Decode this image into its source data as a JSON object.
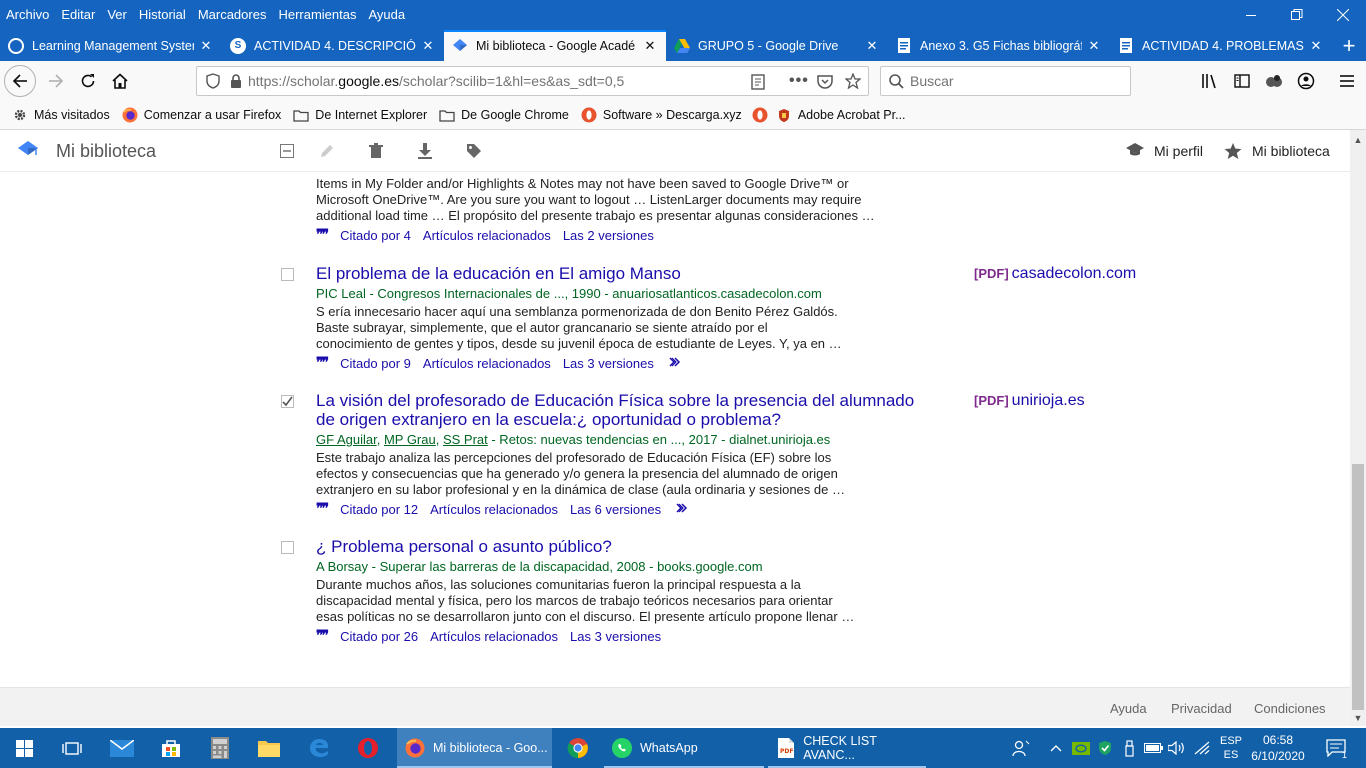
{
  "browser": {
    "menu": [
      "Archivo",
      "Editar",
      "Ver",
      "Historial",
      "Marcadores",
      "Herramientas",
      "Ayuda"
    ],
    "tabs": [
      {
        "title": "Learning Management System",
        "icon": "globe-icon"
      },
      {
        "title": "ACTIVIDAD 4. DESCRIPCIÓN DE",
        "icon": "s-logo-icon"
      },
      {
        "title": "Mi biblioteca - Google Acadé",
        "icon": "scholar-icon"
      },
      {
        "title": "GRUPO 5 - Google Drive",
        "icon": "drive-icon"
      },
      {
        "title": "Anexo 3. G5 Fichas bibliográfic",
        "icon": "docs-icon"
      },
      {
        "title": "ACTIVIDAD 4. PROBLEMAS PE",
        "icon": "docs-icon"
      }
    ],
    "url_prefix": "https://scholar.",
    "url_domain": "google.es",
    "url_suffix": "/scholar?scilib=1&hl=es&as_sdt=0,5",
    "search_placeholder": "Buscar",
    "bookmarks": [
      {
        "label": "Más visitados",
        "icon": "gear-icon"
      },
      {
        "label": "Comenzar a usar Firefox",
        "icon": "firefox-icon"
      },
      {
        "label": "De Internet Explorer",
        "icon": "folder-icon"
      },
      {
        "label": "De Google Chrome",
        "icon": "folder-icon"
      },
      {
        "label": "Software » Descarga.xyz",
        "icon": "opera-icon"
      },
      {
        "label": "",
        "icon": "opera-icon"
      },
      {
        "label": "Adobe Acrobat Pr...",
        "icon": "shield-icon"
      }
    ]
  },
  "library": {
    "title": "Mi biblioteca",
    "profile_link": "Mi perfil",
    "library_link": "Mi biblioteca"
  },
  "results": [
    {
      "title": "",
      "meta": "",
      "snippet": [
        "Items in My Folder and/or Highlights & Notes may not have been saved to Google Drive™ or",
        "Microsoft OneDrive™. Are you sure you want to logout … ListenLarger documents may require",
        "additional load time … El propósito del presente trabajo es presentar algunas consideraciones …"
      ],
      "cited": "Citado por 4",
      "related": "Artículos relacionados",
      "versions": "Las 2 versiones",
      "checked": false
    },
    {
      "title": "El problema de la educación en El amigo Manso",
      "meta": "PIC Leal - Congresos Internacionales de ..., 1990 - anuariosatlanticos.casadecolon.com",
      "snippet": [
        "S ería innecesario hacer aquí una semblanza pormenorizada de don Benito Pérez Galdós.",
        "Baste subrayar, simplemente, que el autor grancanario se siente atraído por el",
        "conocimiento de gentes y tipos, desde su juvenil época de estudiante de Leyes. Y, ya en …"
      ],
      "cited": "Citado por 9",
      "related": "Artículos relacionados",
      "versions": "Las 3 versiones",
      "checked": false,
      "pdf_label": "[PDF]",
      "pdf_source": "casadecolon.com"
    },
    {
      "title_line1": "La visión del profesorado de Educación Física sobre la presencia del alumnado",
      "title_line2": "de origen extranjero en la escuela:¿ oportunidad o problema?",
      "authors": [
        "GF Aguilar",
        "MP Grau",
        "SS Prat"
      ],
      "meta_rest": " - Retos: nuevas tendencias en ..., 2017 - dialnet.unirioja.es",
      "snippet": [
        "Este trabajo analiza las percepciones del profesorado de Educación Física (EF) sobre los",
        "efectos y consecuencias que ha generado y/o genera la presencia del alumnado de origen",
        "extranjero en su labor profesional y en la dinámica de clase (aula ordinaria y sesiones de …"
      ],
      "cited": "Citado por 12",
      "related": "Artículos relacionados",
      "versions": "Las 6 versiones",
      "checked": true,
      "pdf_label": "[PDF]",
      "pdf_source": "unirioja.es"
    },
    {
      "title": "¿ Problema personal o asunto público?",
      "meta": "A Borsay - Superar las barreras de la discapacidad, 2008 - books.google.com",
      "snippet": [
        "Durante muchos años, las soluciones comunitarias fueron la principal respuesta a la",
        "discapacidad mental y física, pero los marcos de trabajo teóricos necesarios para orientar",
        "esas políticas no se desarrollaron junto con el discurso. El presente artículo propone llenar …"
      ],
      "cited": "Citado por 26",
      "related": "Artículos relacionados",
      "versions": "Las 3 versiones",
      "checked": false
    }
  ],
  "footer": {
    "help": "Ayuda",
    "privacy": "Privacidad",
    "terms": "Condiciones"
  },
  "taskbar": {
    "apps": [
      {
        "label": "Mi biblioteca - Goo...",
        "icon": "firefox-icon"
      },
      {
        "label": "WhatsApp",
        "icon": "whatsapp-icon"
      },
      {
        "label": "CHECK LIST AVANC...",
        "icon": "pdf-icon"
      }
    ],
    "lang_line1": "ESP",
    "lang_line2": "ES",
    "time": "06:58",
    "date": "6/10/2020",
    "notification_count": "1"
  }
}
